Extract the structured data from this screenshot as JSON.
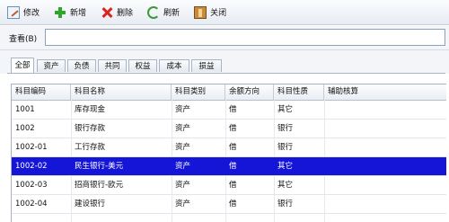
{
  "toolbar": {
    "buttons": [
      {
        "label": "修改",
        "icon": "edit-icon"
      },
      {
        "label": "新增",
        "icon": "add-icon"
      },
      {
        "label": "删除",
        "icon": "delete-icon"
      },
      {
        "label": "刷新",
        "icon": "refresh-icon"
      },
      {
        "label": "关闭",
        "icon": "close-icon"
      }
    ]
  },
  "search": {
    "label": "查看(B)",
    "value": ""
  },
  "tabs": [
    {
      "label": "全部",
      "active": true
    },
    {
      "label": "资产"
    },
    {
      "label": "负债"
    },
    {
      "label": "共同"
    },
    {
      "label": "权益"
    },
    {
      "label": "成本"
    },
    {
      "label": "损益"
    }
  ],
  "table": {
    "columns": [
      "科目编码",
      "科目名称",
      "科目类别",
      "余额方向",
      "科目性质",
      "辅助核算"
    ],
    "rows": [
      [
        "1001",
        "库存现金",
        "资产",
        "借",
        "其它",
        ""
      ],
      [
        "1002",
        "银行存款",
        "资产",
        "借",
        "银行",
        ""
      ],
      [
        "1002-01",
        "工行存款",
        "资产",
        "借",
        "银行",
        ""
      ],
      [
        "1002-02",
        "民生银行-美元",
        "资产",
        "借",
        "其它",
        ""
      ],
      [
        "1002-03",
        "招商银行-欧元",
        "资产",
        "借",
        "其它",
        ""
      ],
      [
        "1002-04",
        "建设银行",
        "资产",
        "借",
        "银行",
        ""
      ]
    ],
    "selected_row": 3
  },
  "colors": {
    "selection": "#1515d8"
  }
}
